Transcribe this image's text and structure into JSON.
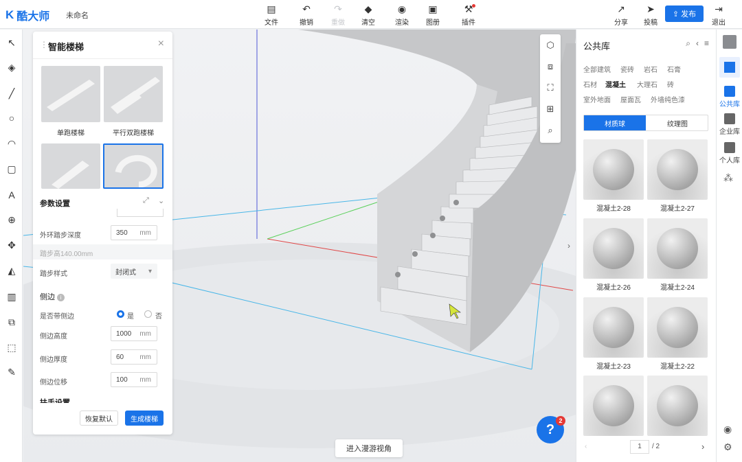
{
  "app": {
    "name": "酷大师",
    "doc_name": "未命名"
  },
  "toolbar": [
    {
      "label": "文件",
      "icon": "file-icon"
    },
    {
      "label": "撤销",
      "icon": "undo-icon"
    },
    {
      "label": "重做",
      "icon": "redo-icon"
    },
    {
      "label": "清空",
      "icon": "eraser-icon"
    },
    {
      "label": "渲染",
      "icon": "render-icon"
    },
    {
      "label": "图册",
      "icon": "album-icon"
    },
    {
      "label": "插件",
      "icon": "plugin-icon"
    }
  ],
  "top_right": {
    "share": "分享",
    "feedback": "投稿",
    "publish": "发布",
    "exit": "退出"
  },
  "stair_panel": {
    "title": "智能楼梯",
    "types": [
      {
        "label": "单跑楼梯"
      },
      {
        "label": "平行双跑楼梯"
      },
      {
        "label": ""
      },
      {
        "label": ""
      }
    ],
    "params_title": "参数设置",
    "outer_step_depth_label": "外环踏步深度",
    "outer_step_depth_value": "350",
    "unit": "mm",
    "hint": "踏步高140.00mm",
    "step_style_label": "踏步样式",
    "step_style_value": "封闭式",
    "side_section": "侧边",
    "has_side_label": "是否带侧边",
    "yes": "是",
    "no": "否",
    "side_height_label": "侧边高度",
    "side_height_value": "1000",
    "side_thickness_label": "侧边厚度",
    "side_thickness_value": "60",
    "side_offset_label": "侧边位移",
    "side_offset_value": "100",
    "handrail_section": "扶手设置",
    "reset": "恢复默认",
    "generate": "生成楼梯"
  },
  "library": {
    "title": "公共库",
    "categories": [
      "全部建筑",
      "瓷砖",
      "岩石",
      "石膏",
      "石材",
      "混凝土",
      "大理石",
      "砖",
      "室外地面",
      "屋面瓦",
      "外墙纯色漆"
    ],
    "active_category": "混凝土",
    "tabs": [
      "材质球",
      "纹理图"
    ],
    "materials": [
      "混凝土2-28",
      "混凝土2-27",
      "混凝土2-26",
      "混凝土2-24",
      "混凝土2-23",
      "混凝土2-22",
      "",
      ""
    ],
    "page_current": "1",
    "page_total": "/ 2"
  },
  "side_nav": [
    "公共库",
    "企业库",
    "个人库"
  ],
  "viewport": {
    "roam_button": "进入漫游视角",
    "help_badge": "2",
    "help_label": "?"
  },
  "colors": {
    "accent": "#1a73e8",
    "badge": "#e53935"
  }
}
